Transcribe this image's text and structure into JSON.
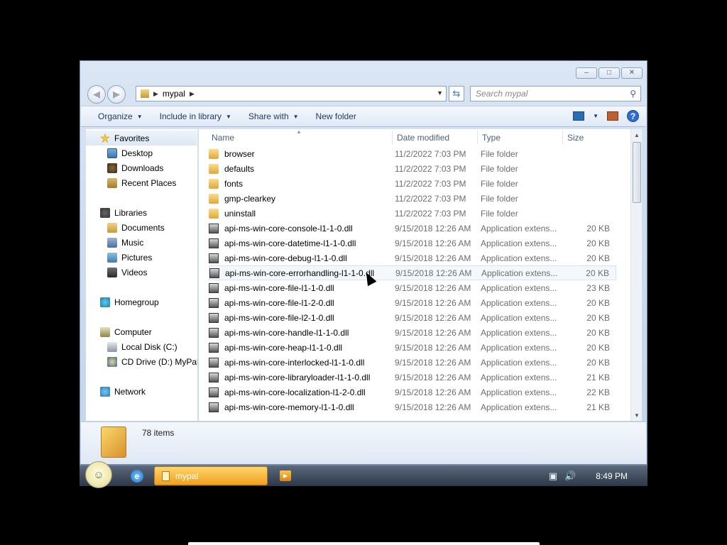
{
  "window": {
    "controls": {
      "minimize": "–",
      "restore": "□",
      "close": "✕"
    }
  },
  "address": {
    "path": "mypal",
    "search_placeholder": "Search mypal"
  },
  "toolbar": {
    "organize": "Organize",
    "include_in_library": "Include in library",
    "share_with": "Share with",
    "new_folder": "New folder",
    "help": "?"
  },
  "nav": {
    "favorites": "Favorites",
    "desktop": "Desktop",
    "downloads": "Downloads",
    "recent_places": "Recent Places",
    "libraries": "Libraries",
    "documents": "Documents",
    "music": "Music",
    "pictures": "Pictures",
    "videos": "Videos",
    "homegroup": "Homegroup",
    "computer": "Computer",
    "local_disk": "Local Disk (C:)",
    "cd_drive": "CD Drive (D:) MyPal",
    "network": "Network"
  },
  "columns": {
    "name": "Name",
    "date": "Date modified",
    "type": "Type",
    "size": "Size"
  },
  "files": [
    {
      "name": "browser",
      "date": "11/2/2022 7:03 PM",
      "type": "File folder",
      "size": "",
      "kind": "folder"
    },
    {
      "name": "defaults",
      "date": "11/2/2022 7:03 PM",
      "type": "File folder",
      "size": "",
      "kind": "folder"
    },
    {
      "name": "fonts",
      "date": "11/2/2022 7:03 PM",
      "type": "File folder",
      "size": "",
      "kind": "folder"
    },
    {
      "name": "gmp-clearkey",
      "date": "11/2/2022 7:03 PM",
      "type": "File folder",
      "size": "",
      "kind": "folder"
    },
    {
      "name": "uninstall",
      "date": "11/2/2022 7:03 PM",
      "type": "File folder",
      "size": "",
      "kind": "folder"
    },
    {
      "name": "api-ms-win-core-console-l1-1-0.dll",
      "date": "9/15/2018 12:26 AM",
      "type": "Application extens...",
      "size": "20 KB",
      "kind": "dll"
    },
    {
      "name": "api-ms-win-core-datetime-l1-1-0.dll",
      "date": "9/15/2018 12:26 AM",
      "type": "Application extens...",
      "size": "20 KB",
      "kind": "dll"
    },
    {
      "name": "api-ms-win-core-debug-l1-1-0.dll",
      "date": "9/15/2018 12:26 AM",
      "type": "Application extens...",
      "size": "20 KB",
      "kind": "dll"
    },
    {
      "name": "api-ms-win-core-errorhandling-l1-1-0.dll",
      "date": "9/15/2018 12:26 AM",
      "type": "Application extens...",
      "size": "20 KB",
      "kind": "dll"
    },
    {
      "name": "api-ms-win-core-file-l1-1-0.dll",
      "date": "9/15/2018 12:26 AM",
      "type": "Application extens...",
      "size": "23 KB",
      "kind": "dll"
    },
    {
      "name": "api-ms-win-core-file-l1-2-0.dll",
      "date": "9/15/2018 12:26 AM",
      "type": "Application extens...",
      "size": "20 KB",
      "kind": "dll"
    },
    {
      "name": "api-ms-win-core-file-l2-1-0.dll",
      "date": "9/15/2018 12:26 AM",
      "type": "Application extens...",
      "size": "20 KB",
      "kind": "dll"
    },
    {
      "name": "api-ms-win-core-handle-l1-1-0.dll",
      "date": "9/15/2018 12:26 AM",
      "type": "Application extens...",
      "size": "20 KB",
      "kind": "dll"
    },
    {
      "name": "api-ms-win-core-heap-l1-1-0.dll",
      "date": "9/15/2018 12:26 AM",
      "type": "Application extens...",
      "size": "20 KB",
      "kind": "dll"
    },
    {
      "name": "api-ms-win-core-interlocked-l1-1-0.dll",
      "date": "9/15/2018 12:26 AM",
      "type": "Application extens...",
      "size": "20 KB",
      "kind": "dll"
    },
    {
      "name": "api-ms-win-core-libraryloader-l1-1-0.dll",
      "date": "9/15/2018 12:26 AM",
      "type": "Application extens...",
      "size": "21 KB",
      "kind": "dll"
    },
    {
      "name": "api-ms-win-core-localization-l1-2-0.dll",
      "date": "9/15/2018 12:26 AM",
      "type": "Application extens...",
      "size": "22 KB",
      "kind": "dll"
    },
    {
      "name": "api-ms-win-core-memory-l1-1-0.dll",
      "date": "9/15/2018 12:26 AM",
      "type": "Application extens...",
      "size": "21 KB",
      "kind": "dll"
    }
  ],
  "details": {
    "count": "78 items"
  },
  "taskbar": {
    "task_label": "mypal",
    "clock": "8:49 PM"
  },
  "colors": {
    "accent": "#f0a020",
    "selection": "#dde8f5"
  }
}
